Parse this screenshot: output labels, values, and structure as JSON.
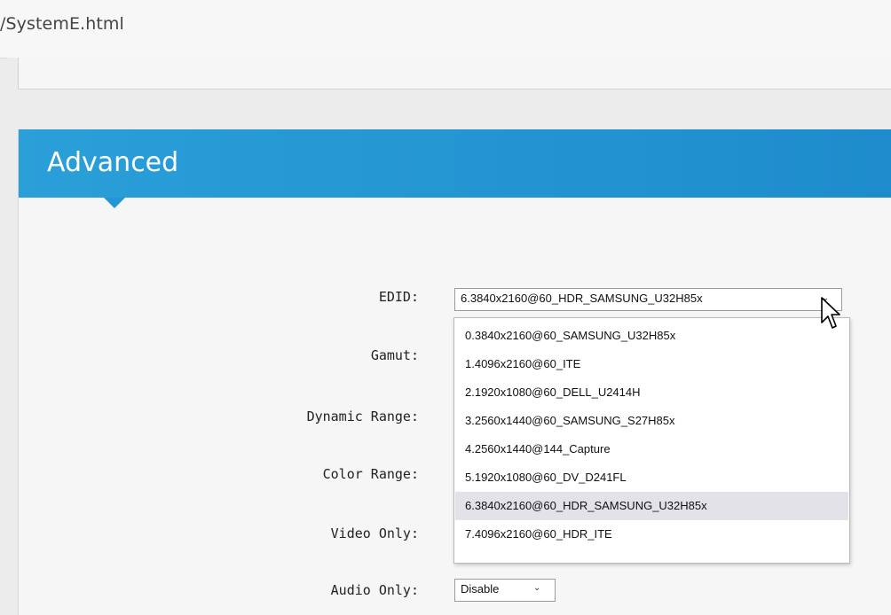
{
  "browser": {
    "url_fragment": "/SystemE.html"
  },
  "section": {
    "title": "Advanced"
  },
  "fields": [
    {
      "label": "EDID:",
      "value": "6.3840x2160@60_HDR_SAMSUNG_U32H85x"
    },
    {
      "label": "Gamut:"
    },
    {
      "label": "Dynamic Range:"
    },
    {
      "label": "Color Range:"
    },
    {
      "label": "Video Only:"
    },
    {
      "label": "Audio Only:",
      "value": "Disable"
    }
  ],
  "edid_dropdown": {
    "options": [
      "0.3840x2160@60_SAMSUNG_U32H85x",
      "1.4096x2160@60_ITE",
      "2.1920x1080@60_DELL_U2414H",
      "3.2560x1440@60_SAMSUNG_S27H85x",
      "4.2560x1440@144_Capture",
      "5.1920x1080@60_DV_D241FL",
      "6.3840x2160@60_HDR_SAMSUNG_U32H85x",
      "7.4096x2160@60_HDR_ITE"
    ],
    "selected_index": 6
  },
  "colors": {
    "accent": "#2596d3",
    "panel_background": "#f6f6f6",
    "selected_option": "#e2e2e8"
  },
  "icons": {
    "chevron": "chevron-down-icon",
    "cursor": "mouse-pointer-icon"
  }
}
